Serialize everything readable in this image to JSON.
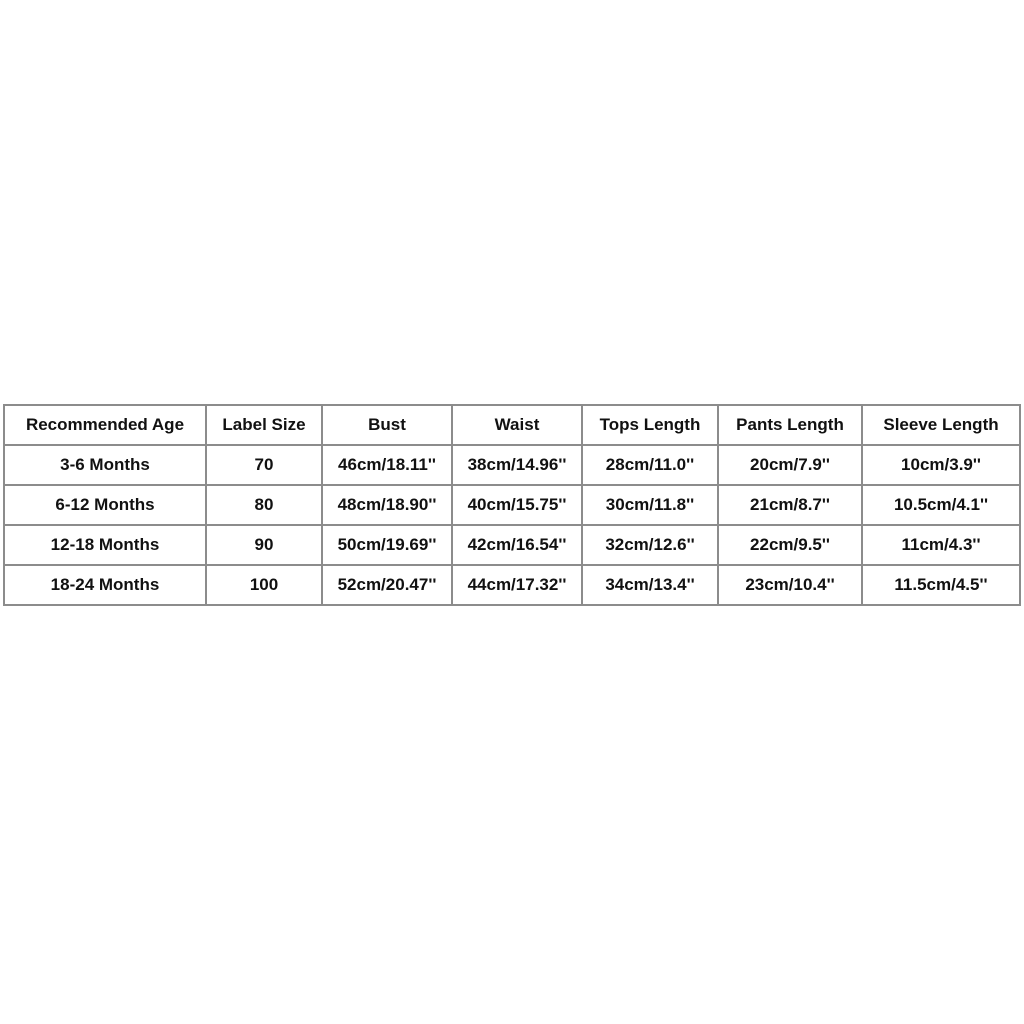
{
  "size_chart": {
    "headers": [
      "Recommended Age",
      "Label Size",
      "Bust",
      "Waist",
      "Tops Length",
      "Pants Length",
      "Sleeve Length"
    ],
    "rows": [
      [
        "3-6 Months",
        "70",
        "46cm/18.11''",
        "38cm/14.96''",
        "28cm/11.0''",
        "20cm/7.9''",
        "10cm/3.9''"
      ],
      [
        "6-12 Months",
        "80",
        "48cm/18.90''",
        "40cm/15.75''",
        "30cm/11.8''",
        "21cm/8.7''",
        "10.5cm/4.1''"
      ],
      [
        "12-18 Months",
        "90",
        "50cm/19.69''",
        "42cm/16.54''",
        "32cm/12.6''",
        "22cm/9.5''",
        "11cm/4.3''"
      ],
      [
        "18-24 Months",
        "100",
        "52cm/20.47''",
        "44cm/17.32''",
        "34cm/13.4''",
        "23cm/10.4''",
        "11.5cm/4.5''"
      ]
    ]
  }
}
